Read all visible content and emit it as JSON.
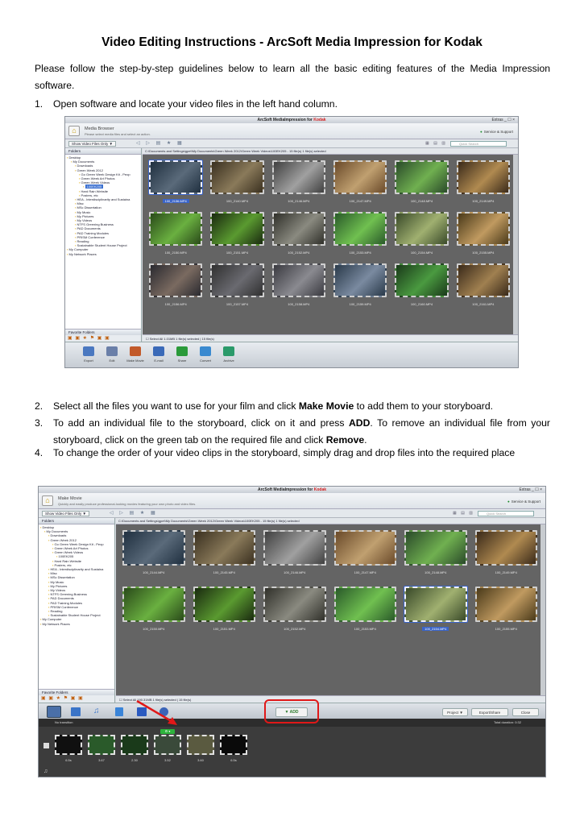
{
  "document": {
    "title": "Video Editing Instructions - ArcSoft Media Impression for Kodak",
    "intro": "Please follow the step-by-step guidelines below to learn all the basic editing features of the Media Impression software.",
    "step1": {
      "num": "1.",
      "text": "Open software and locate your video files in the left hand column."
    },
    "step2": {
      "num": "2.",
      "pre": "Select all the files you want to use for your film and click ",
      "bold": "Make Movie",
      "post": " to add them to your storyboard."
    },
    "step3": {
      "num": "3.",
      "pre": "To add an individual file to the storyboard, click on it and press ",
      "bold1": "ADD",
      "mid": ". To remove an individual file from your storyboard, click on the green tab on the required file and click ",
      "bold2": "Remove",
      "post": "."
    },
    "step4": {
      "num": "4.",
      "text": "To change the order of your video clips in the storyboard, simply drag and drop files into the required place"
    }
  },
  "screenshot1": {
    "window_title": "ArcSoft MediaImpression for",
    "brand": "Kodak",
    "window_controls": "Extras _ ☐ ×",
    "header_title": "Media Browser",
    "header_sub": "Please select media files and select an action.",
    "support": "Service & Support",
    "show_btn": "Show Video Files Only ▼",
    "search_placeholder": "Quick Search",
    "folders_label": "Folders",
    "path": "C:\\Documents and Settings\\gpet\\My Documents\\Green Week 2012\\Green Week Videos\\100EK205 - 15 file(s)    1 file(s) selected",
    "tree": [
      "Desktop",
      "My Documents",
      "Downloads",
      "Green Week 2012",
      "Go Green Week Design Kit - Peop",
      "Green Week Art Photos",
      "Green Week Videos",
      "100EK205",
      "Hard Rain Website",
      "Posters, etc",
      "HEA - Interdisciplinarity and Sustaina",
      "Misc",
      "MSc Dissertation",
      "My Music",
      "My Pictures",
      "My Videos",
      "NTFS Greening Business",
      "PAD Documents",
      "PAD Training Modules",
      "PRISM Conference",
      "Reading",
      "Sustainable Student House Project",
      "My Computer",
      "My Network Places"
    ],
    "favorites_label": "Favorite Folders",
    "clips": [
      "100_2136.MP4",
      "100_2140.MP4",
      "100_2146.MP4",
      "100_2147.MP4",
      "100_2148.MP4",
      "100_2149.MP4",
      "100_2150.MP4",
      "100_2151.MP4",
      "100_2152.MP4",
      "100_2153.MP4",
      "100_2154.MP4",
      "100_2155.MP4",
      "100_2156.MP4",
      "100_2157.MP4",
      "100_2158.MP4",
      "100_2159.MP4",
      "100_2160.MP4",
      "100_2161.MP4"
    ],
    "status": "☐ Select All        1.01MB                     1 file(s) selected | 15 file(s)",
    "actions": [
      "Export",
      "Edit",
      "Make Movie",
      "E-mail",
      "Share",
      "Convert",
      "Archive"
    ],
    "action_colors": [
      "#4a78c0",
      "#6a7fa8",
      "#c25a2a",
      "#3a6ab8",
      "#2a9a3a",
      "#3a8ad0",
      "#2a9a6a"
    ]
  },
  "screenshot2": {
    "window_title": "ArcSoft MediaImpression for",
    "brand": "Kodak",
    "window_controls": "Extras _ ☐ ×",
    "header_title": "Make Movie",
    "header_sub": "Quickly and easily produce professional-looking movies featuring your own photo and video files.",
    "support": "Service & Support",
    "show_btn": "Show Video Files Only ▼",
    "search_placeholder": "Quick Search",
    "folders_label": "Folders",
    "path": "C:\\Documents and Settings\\gpet\\My Documents\\Green Week 2012\\Green Week Videos\\100EK205 - 15 file(s)    1 file(s) selected",
    "tree": [
      "Desktop",
      "My Documents",
      "Downloads",
      "Green Week 2012",
      "Go Green Week Design Kit - Peop",
      "Green Week Art Photos",
      "Green Week Videos",
      "100EK205",
      "Hard Rain Website",
      "Posters, etc",
      "HEA - Interdisciplinarity and Sustaina",
      "Misc",
      "MSc Dissertation",
      "My Music",
      "My Pictures",
      "My Videos",
      "NTFS Greening Business",
      "PAD Documents",
      "PAD Training Modules",
      "PRISM Conference",
      "Reading",
      "Sustainable Student House Project",
      "My Computer",
      "My Network Places"
    ],
    "favorites_label": "Favorite Folders",
    "clips": [
      "100_2144.MP4",
      "100_2145.MP4",
      "100_2146.MP4",
      "100_2147.MP4",
      "100_2148.MP4",
      "100_2149.MP4",
      "100_2150.MP4",
      "100_2151.MP4",
      "100_2152.MP4",
      "100_2153.MP4",
      "100_2154.MP4",
      "100_2155.MP4"
    ],
    "status": "☐ Select All        190.31MB                  1 file(s) selected | 15 file(s)",
    "add_label": "▼ ADD",
    "project_btn": "Project ▼",
    "export_btn": "Export/Share",
    "close_btn": "Close",
    "no_transition": "No transition",
    "total_duration": "Total duration:   0:32",
    "story_times": [
      "6.5s",
      "3.67",
      "2.30",
      "3.52",
      "3.60",
      "6.5s"
    ],
    "tag_label": "⚙ ▾"
  },
  "colors": {
    "highlight": "#e01818",
    "selection": "#3a64c8",
    "tag_green": "#2db43c"
  }
}
